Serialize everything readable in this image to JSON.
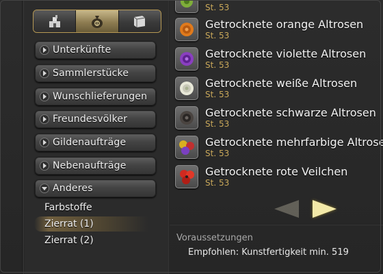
{
  "filter_tabs": [
    {
      "icon": "house-icon",
      "active": false
    },
    {
      "icon": "money-bag-icon",
      "active": true
    },
    {
      "icon": "book-icon",
      "active": false
    }
  ],
  "categories": [
    {
      "label": "Unterkünfte",
      "expanded": false
    },
    {
      "label": "Sammlerstücke",
      "expanded": false
    },
    {
      "label": "Wunschlieferungen",
      "expanded": false
    },
    {
      "label": "Freundesvölker",
      "expanded": false
    },
    {
      "label": "Gildenaufträge",
      "expanded": false
    },
    {
      "label": "Nebenaufträge",
      "expanded": false
    },
    {
      "label": "Anderes",
      "expanded": true
    }
  ],
  "subcategories": [
    {
      "label": "Farbstoffe",
      "selected": false
    },
    {
      "label": "Zierrat (1)",
      "selected": true
    },
    {
      "label": "Zierrat (2)",
      "selected": false
    }
  ],
  "items": [
    {
      "name": "",
      "level": "St. 53",
      "color": "#7fae3a"
    },
    {
      "name": "Getrocknete orange Altrosen",
      "level": "St. 53",
      "color": "#e07a1c"
    },
    {
      "name": "Getrocknete violette Altrosen",
      "level": "St. 53",
      "color": "#8a3fc0"
    },
    {
      "name": "Getrocknete weiße Altrosen",
      "level": "St. 53",
      "color": "#e8e8d8"
    },
    {
      "name": "Getrocknete schwarze Altrosen",
      "level": "St. 53",
      "color": "#4a4440"
    },
    {
      "name": "Getrocknete mehrfarbige Altrosen",
      "level": "St. 53",
      "color": "#d8b020"
    },
    {
      "name": "Getrocknete rote Veilchen",
      "level": "St. 53",
      "color": "#d02a20"
    }
  ],
  "pager": {
    "prev_enabled": false,
    "next_enabled": true
  },
  "requirements": {
    "title": "Voraussetzungen",
    "value": "Empfohlen: Kunstfertigkeit min. 519"
  }
}
